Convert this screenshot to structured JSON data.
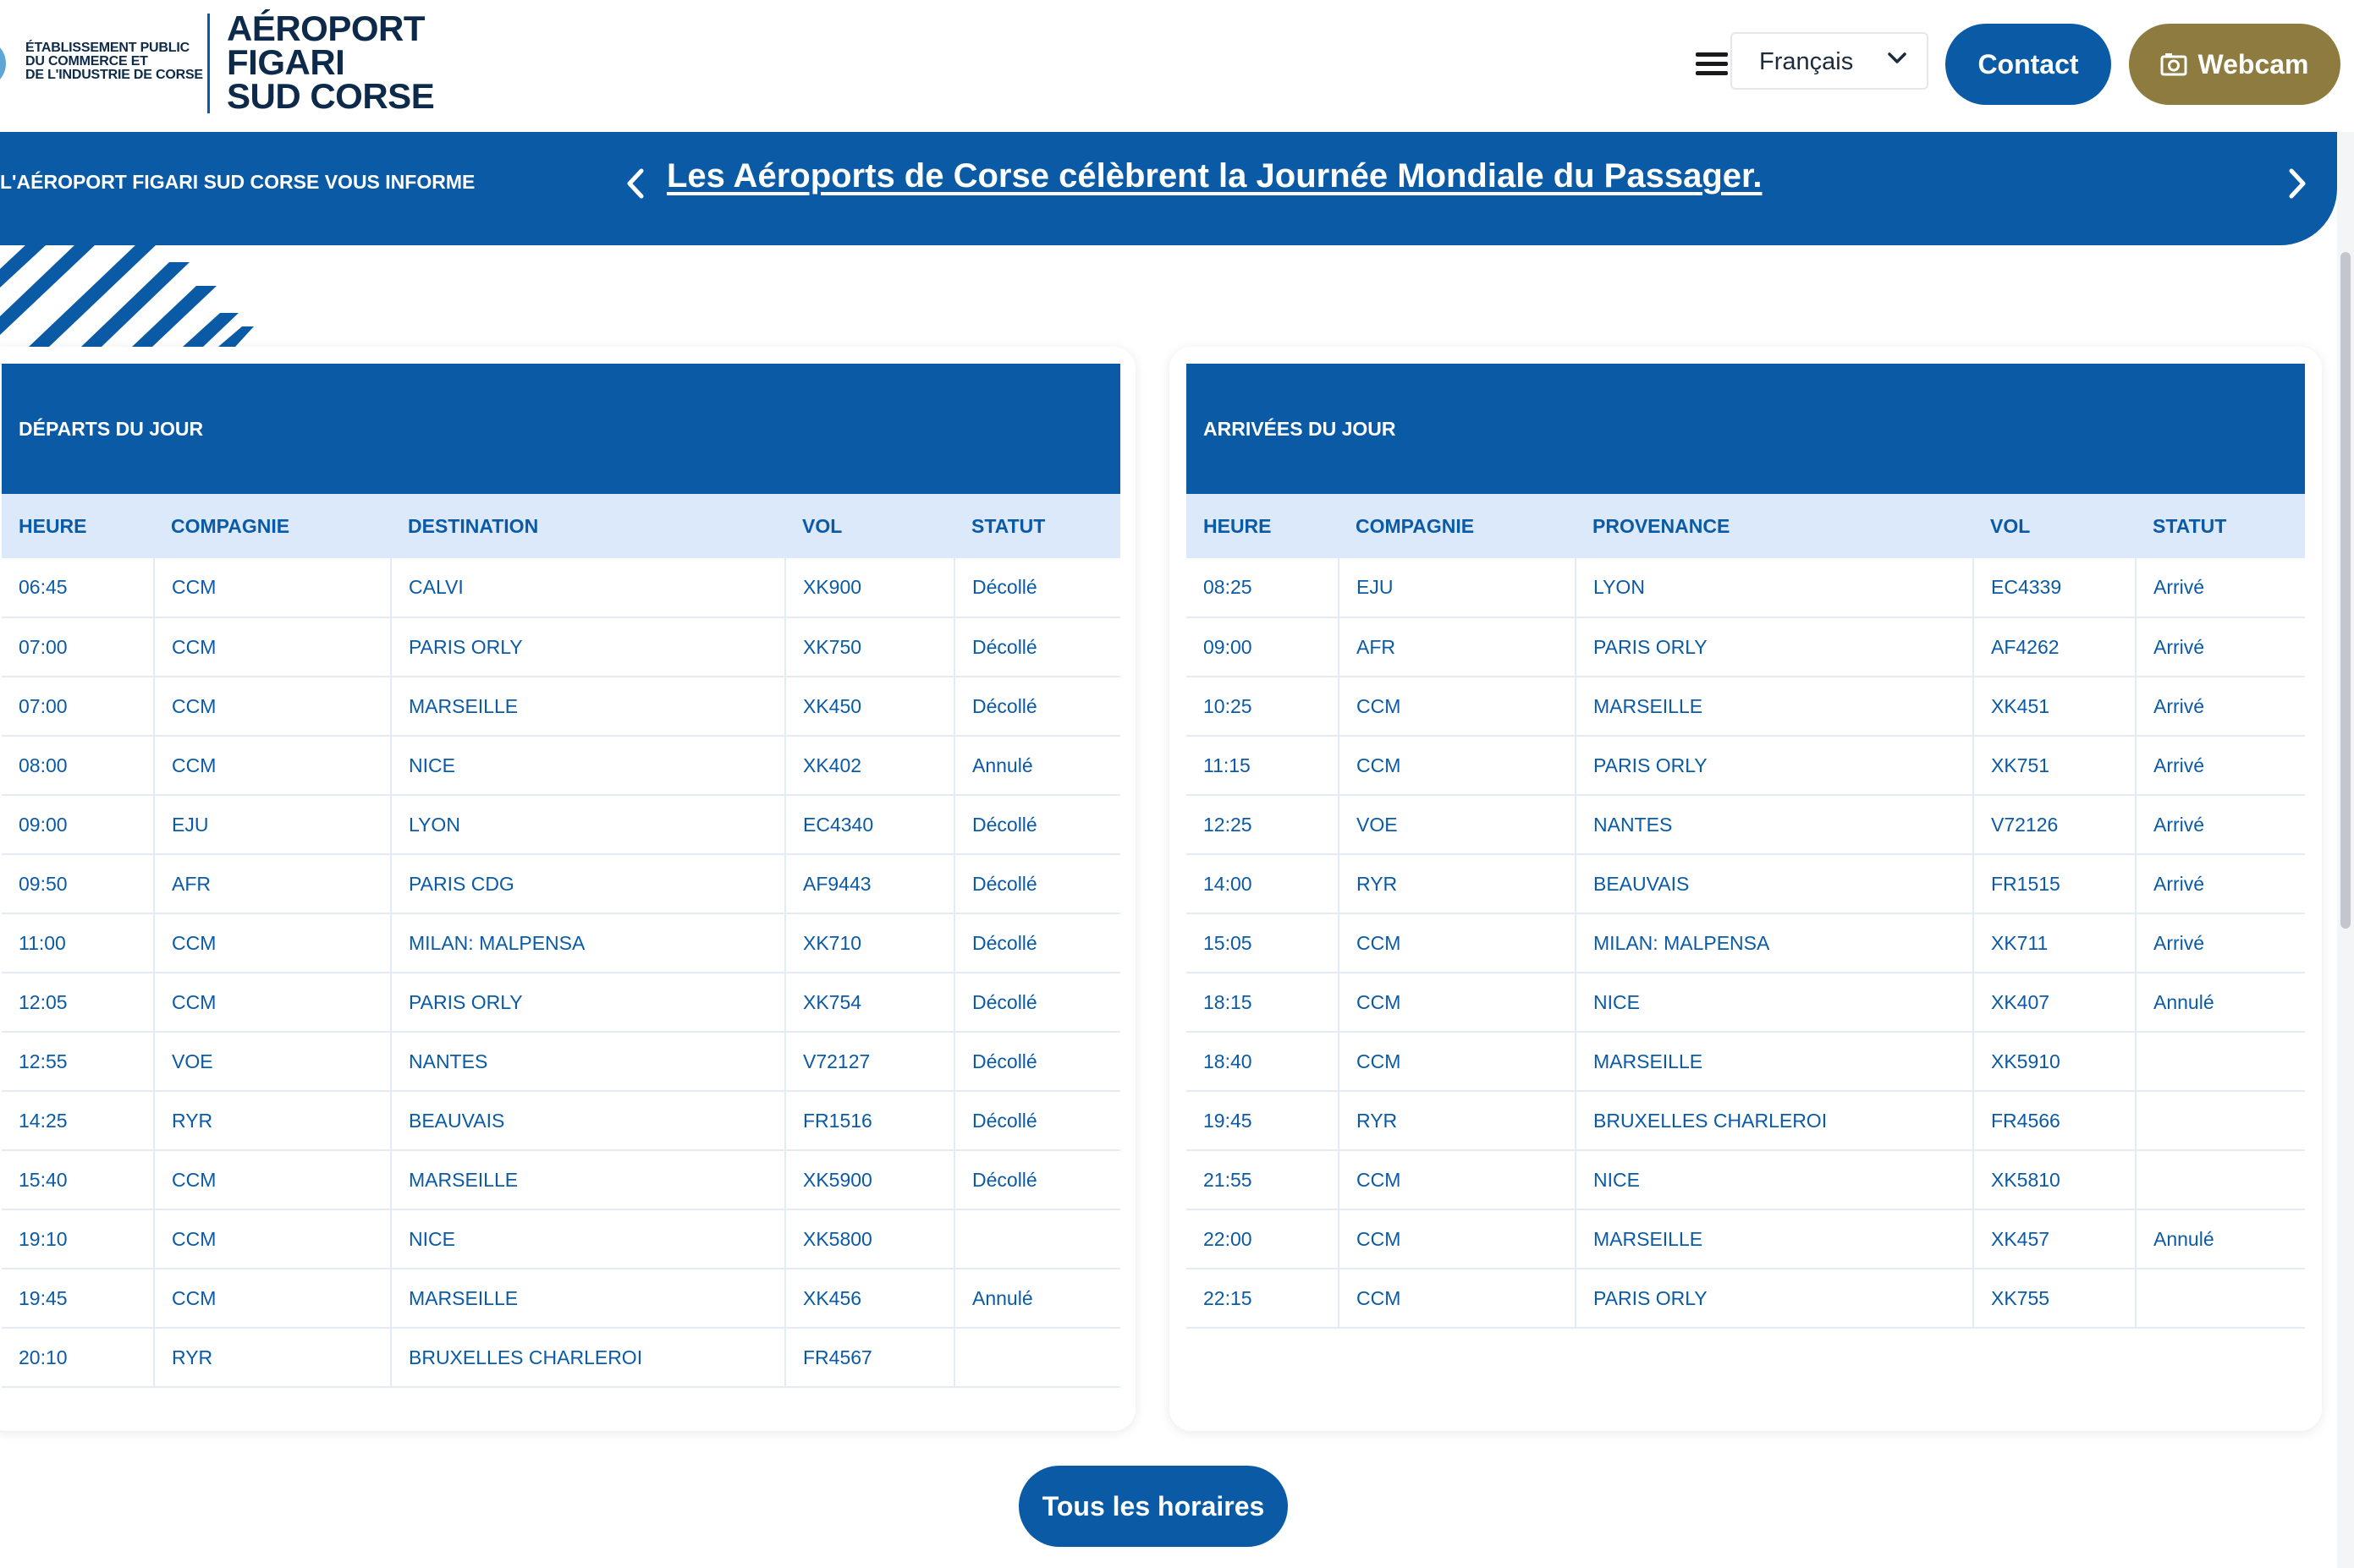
{
  "header": {
    "cci_lines": [
      "Établissement public",
      "du commerce et",
      "de l'industrie de Corse"
    ],
    "brand_lines": [
      "AÉROPORT",
      "FIGARI",
      "SUD CORSE"
    ],
    "language": "Français",
    "contact_label": "Contact",
    "webcam_label": "Webcam"
  },
  "news": {
    "label": "L'AÉROPORT FIGARI SUD CORSE VOUS INFORME",
    "headline": "Les Aéroports de Corse célèbrent la Journée Mondiale du Passager."
  },
  "departures": {
    "title": "Départs du jour",
    "columns": [
      "HEURE",
      "COMPAGNIE",
      "DESTINATION",
      "VOL",
      "STATUT"
    ],
    "rows": [
      [
        "06:45",
        "CCM",
        "CALVI",
        "XK900",
        "Décollé"
      ],
      [
        "07:00",
        "CCM",
        "PARIS ORLY",
        "XK750",
        "Décollé"
      ],
      [
        "07:00",
        "CCM",
        "MARSEILLE",
        "XK450",
        "Décollé"
      ],
      [
        "08:00",
        "CCM",
        "NICE",
        "XK402",
        "Annulé"
      ],
      [
        "09:00",
        "EJU",
        "LYON",
        "EC4340",
        "Décollé"
      ],
      [
        "09:50",
        "AFR",
        "PARIS CDG",
        "AF9443",
        "Décollé"
      ],
      [
        "11:00",
        "CCM",
        "MILAN: MALPENSA",
        "XK710",
        "Décollé"
      ],
      [
        "12:05",
        "CCM",
        "PARIS ORLY",
        "XK754",
        "Décollé"
      ],
      [
        "12:55",
        "VOE",
        "NANTES",
        "V72127",
        "Décollé"
      ],
      [
        "14:25",
        "RYR",
        "BEAUVAIS",
        "FR1516",
        "Décollé"
      ],
      [
        "15:40",
        "CCM",
        "MARSEILLE",
        "XK5900",
        "Décollé"
      ],
      [
        "19:10",
        "CCM",
        "NICE",
        "XK5800",
        ""
      ],
      [
        "19:45",
        "CCM",
        "MARSEILLE",
        "XK456",
        "Annulé"
      ],
      [
        "20:10",
        "RYR",
        "BRUXELLES CHARLEROI",
        "FR4567",
        ""
      ]
    ]
  },
  "arrivals": {
    "title": "Arrivées du jour",
    "columns": [
      "HEURE",
      "COMPAGNIE",
      "PROVENANCE",
      "VOL",
      "STATUT"
    ],
    "rows": [
      [
        "08:25",
        "EJU",
        "LYON",
        "EC4339",
        "Arrivé"
      ],
      [
        "09:00",
        "AFR",
        "PARIS ORLY",
        "AF4262",
        "Arrivé"
      ],
      [
        "10:25",
        "CCM",
        "MARSEILLE",
        "XK451",
        "Arrivé"
      ],
      [
        "11:15",
        "CCM",
        "PARIS ORLY",
        "XK751",
        "Arrivé"
      ],
      [
        "12:25",
        "VOE",
        "NANTES",
        "V72126",
        "Arrivé"
      ],
      [
        "14:00",
        "RYR",
        "BEAUVAIS",
        "FR1515",
        "Arrivé"
      ],
      [
        "15:05",
        "CCM",
        "MILAN: MALPENSA",
        "XK711",
        "Arrivé"
      ],
      [
        "18:15",
        "CCM",
        "NICE",
        "XK407",
        "Annulé"
      ],
      [
        "18:40",
        "CCM",
        "MARSEILLE",
        "XK5910",
        ""
      ],
      [
        "19:45",
        "RYR",
        "BRUXELLES CHARLEROI",
        "FR4566",
        ""
      ],
      [
        "21:55",
        "CCM",
        "NICE",
        "XK5810",
        ""
      ],
      [
        "22:00",
        "CCM",
        "MARSEILLE",
        "XK457",
        "Annulé"
      ],
      [
        "22:15",
        "CCM",
        "PARIS ORLY",
        "XK755",
        ""
      ]
    ]
  },
  "all_schedules_label": "Tous les horaires",
  "colors": {
    "primary": "#0b5aa6",
    "webcam": "#8d7b3f",
    "table_header_bg": "#dbe9fb"
  },
  "icons": [
    "menu-icon",
    "chevron-down-icon",
    "camera-icon",
    "chevron-left-icon",
    "chevron-right-icon"
  ]
}
